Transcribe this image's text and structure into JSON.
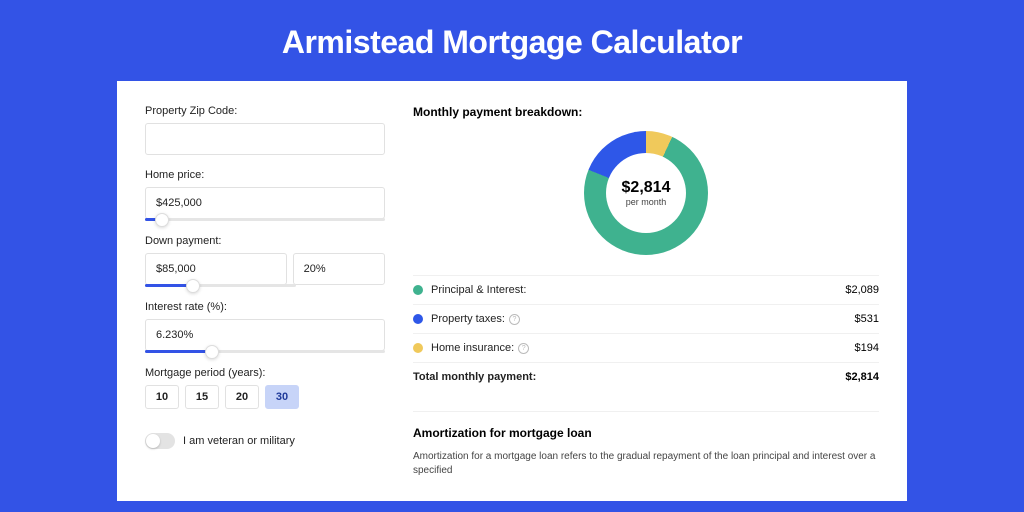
{
  "page": {
    "title": "Armistead Mortgage Calculator"
  },
  "form": {
    "zip": {
      "label": "Property Zip Code:",
      "value": ""
    },
    "price": {
      "label": "Home price:",
      "value": "$425,000",
      "slider_pct": 7
    },
    "down": {
      "label": "Down payment:",
      "value": "$85,000",
      "pct": "20%",
      "slider_pct": 20
    },
    "rate": {
      "label": "Interest rate (%):",
      "value": "6.230%",
      "slider_pct": 28
    },
    "period": {
      "label": "Mortgage period (years):",
      "options": [
        "10",
        "15",
        "20",
        "30"
      ],
      "selected": "30"
    },
    "veteran": {
      "label": "I am veteran or military",
      "on": false
    }
  },
  "breakdown": {
    "title": "Monthly payment breakdown:",
    "donut": {
      "value": "$2,814",
      "sub": "per month"
    },
    "items": [
      {
        "label": "Principal & Interest:",
        "amount": "$2,089",
        "color": "#3fb28f",
        "info": false
      },
      {
        "label": "Property taxes:",
        "amount": "$531",
        "color": "#2e57e8",
        "info": true
      },
      {
        "label": "Home insurance:",
        "amount": "$194",
        "color": "#f0c95b",
        "info": true
      }
    ],
    "total": {
      "label": "Total monthly payment:",
      "amount": "$2,814"
    }
  },
  "amort": {
    "title": "Amortization for mortgage loan",
    "text": "Amortization for a mortgage loan refers to the gradual repayment of the loan principal and interest over a specified"
  },
  "chart_data": {
    "type": "pie",
    "title": "Monthly payment breakdown",
    "categories": [
      "Principal & Interest",
      "Property taxes",
      "Home insurance"
    ],
    "values": [
      2089,
      531,
      194
    ],
    "colors": [
      "#3fb28f",
      "#2e57e8",
      "#f0c95b"
    ],
    "total": 2814,
    "unit": "USD/month"
  }
}
